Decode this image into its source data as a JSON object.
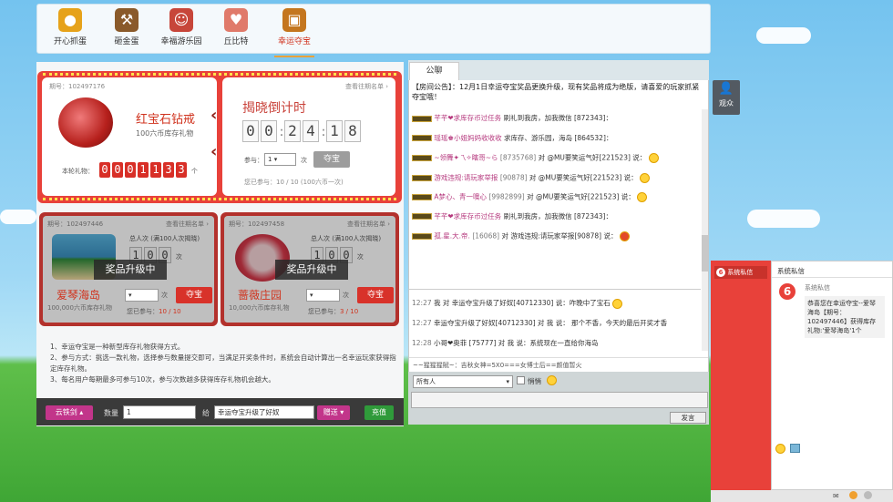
{
  "nav": {
    "items": [
      {
        "label": "开心抓蛋",
        "icon": "golden-egg-icon",
        "color": "#e6a21a"
      },
      {
        "label": "砸金蛋",
        "icon": "hammer-icon",
        "color": "#8a5a2a"
      },
      {
        "label": "幸福游乐园",
        "icon": "cartoon-girl-icon",
        "color": "#c7463a"
      },
      {
        "label": "丘比特",
        "icon": "cupid-icon",
        "color": "#e07a6a"
      },
      {
        "label": "幸运夺宝",
        "icon": "treasure-chest-icon",
        "color": "#c4761e"
      }
    ],
    "active": "幸运夺宝"
  },
  "main_prize": {
    "period": "期号：102497176",
    "history_link": "查看往期名单 ›",
    "name": "红宝石钻戒",
    "price": "100六币库存礼物",
    "round_label": "本轮礼物：",
    "round_digits": [
      "0",
      "0",
      "0",
      "1",
      "1",
      "3",
      "3"
    ],
    "round_unit": "个"
  },
  "countdown": {
    "title": "揭晓倒计时",
    "digits": [
      "0",
      "0",
      "2",
      "4",
      "1",
      "8"
    ],
    "join_label": "参与：",
    "join_select": "1",
    "join_unit": "次",
    "button": "夺宝",
    "status": "您已参与：10 / 10 (100六币一次)"
  },
  "sub_prizes": [
    {
      "period": "期号：102497446",
      "history_link": "查看往期名单 ›",
      "total_label": "总人次 (满100人次揭晓)",
      "total_digits": [
        "1",
        "0",
        "0"
      ],
      "total_unit": "次",
      "upgrade": "奖品升级中",
      "name": "爱琴海岛",
      "price": "100,000六币库存礼物",
      "join_unit": "次",
      "button": "夺宝",
      "status_prefix": "您已参与：",
      "status_value": "10 / 10"
    },
    {
      "period": "期号：102497458",
      "history_link": "查看往期名单 ›",
      "total_label": "总人次 (满100人次揭晓)",
      "total_digits": [
        "1",
        "0",
        "0"
      ],
      "total_unit": "次",
      "upgrade": "奖品升级中",
      "name": "蔷薇庄园",
      "price": "10,000六币库存礼物",
      "join_unit": "次",
      "button": "夺宝",
      "status_prefix": "您已参与：",
      "status_value": "3 / 10"
    }
  ],
  "rules": [
    "1、幸运夺宝是一种新型库存礼物获得方式。",
    "2、参与方式：挑选一款礼物，选择参与数量提交即可，当满足开奖条件时，系统会自动计算出一名幸运玩家获得指定库存礼物。",
    "3、每名用户每期最多可参与10次，参与次数越多获得库存礼物机会越大。"
  ],
  "bottom_bar": {
    "gift_button": "云铁剑 ▴",
    "qty_label": "数量",
    "qty_value": "1",
    "to_label": "给",
    "to_value": "幸运夺宝升级了好奴",
    "send_button": "赠送 ▾",
    "recharge_button": "充值"
  },
  "chat": {
    "tab": "公聊",
    "announcement": "【房间公告】：12月1日幸运夺宝奖品更换升级，现有奖品将成为绝版，请喜爱的玩家抓紧夺宝哦！",
    "messages": [
      {
        "user": "芊芊❤求库存币过任务",
        "id": "",
        "text": "刷礼到我房，加我微信 [872343]："
      },
      {
        "user": "瑶瑶♚小姐妈妈收收收",
        "id": "",
        "text": "求库存、游乐园，海岛 [864532]："
      },
      {
        "user": "~领舞✦乁✧瞎哥~ら",
        "id": "[8735768]",
        "text": "对 @MU要笑运气好[221523] 说："
      },
      {
        "user": "游戏违规:请玩家举报",
        "id": "[90878]",
        "text": "对 @MU要笑运气好[221523] 说："
      },
      {
        "user": "A梦心、青一噢心",
        "id": "[9982899]",
        "text": "对 @MU要笑运气好[221523] 说："
      },
      {
        "user": "芊芊❤求库存币过任务",
        "id": "",
        "text": "刷礼到我房，加我微信 [872343]："
      },
      {
        "user": "孤.星.大.帝.",
        "id": "[16068]",
        "text": "对 游戏违规:请玩家举报[90878] 说："
      }
    ],
    "private": [
      {
        "time": "12:27",
        "text": "我 对 幸运夺宝升级了好奴[40712330] 说：咋晚中了宝石"
      },
      {
        "time": "12:27",
        "text": "幸运夺宝升级了好奴[40712330] 对 我 说：    那个不香，今天的最后开奖才香"
      },
      {
        "time": "12:28",
        "text": "小哥❤奥菲 [75777] 对 我 说：系统现在一直给你海岛"
      }
    ],
    "gift_notice": "~~猩猩猩賦~：吉秋女神=5X0===女博士后==颜值暂火",
    "to_select": "所有人",
    "private_check": "悄悄",
    "send_button": "发言"
  },
  "viewers_button": "观众",
  "pm": {
    "side_title": "系统私信",
    "main_title": "系统私信",
    "sender": "系统私信",
    "message": "恭喜您在幸运夺宝--爱琴海岛【期号：102497446】获得库存礼物:'爱琴海岛'1个"
  },
  "colors": {
    "accent_red": "#e8413a",
    "nav_active": "#d0331e",
    "chat_user": "#b6397e",
    "pm_red": "#e8413a"
  }
}
